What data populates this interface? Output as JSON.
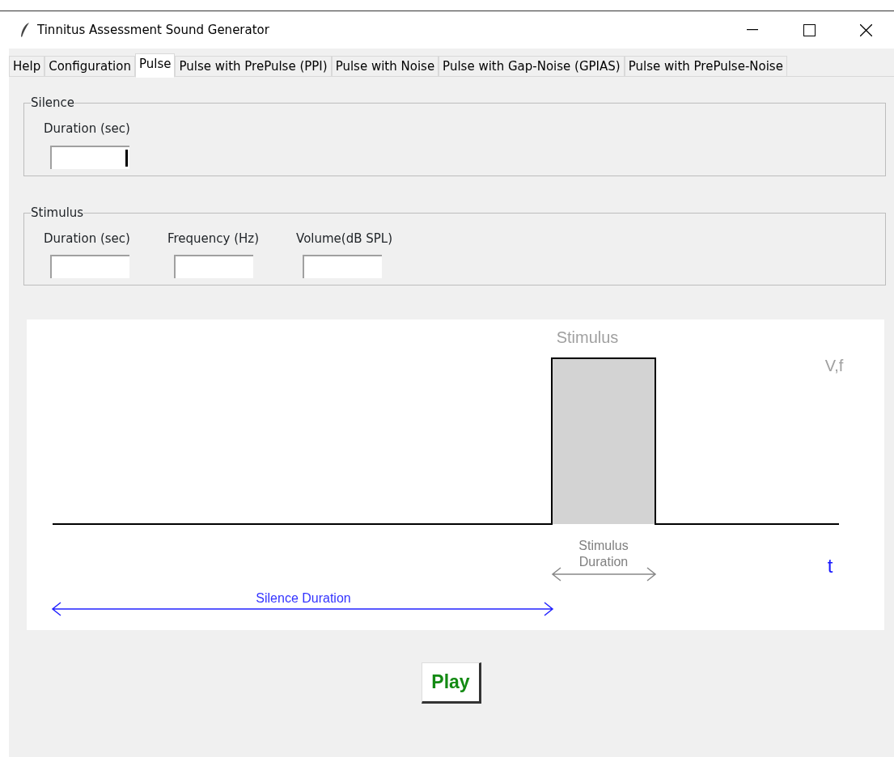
{
  "window": {
    "title": "Tinnitus Assessment Sound Generator"
  },
  "tabs": [
    {
      "label": "Help",
      "selected": false
    },
    {
      "label": "Configuration",
      "selected": false
    },
    {
      "label": "Pulse",
      "selected": true
    },
    {
      "label": "Pulse with PrePulse (PPI)",
      "selected": false
    },
    {
      "label": "Pulse with Noise",
      "selected": false
    },
    {
      "label": "Pulse with Gap-Noise (GPIAS)",
      "selected": false
    },
    {
      "label": "Pulse with PrePulse-Noise",
      "selected": false
    }
  ],
  "groups": [
    {
      "title": "Silence",
      "fields": [
        {
          "label": "Duration (sec)",
          "focused": true
        }
      ]
    },
    {
      "title": "Stimulus",
      "fields": [
        {
          "label": "Duration (sec)",
          "focused": false
        },
        {
          "label": "Frequency (Hz)",
          "focused": false
        },
        {
          "label": "Volume(dB SPL)",
          "focused": false
        }
      ]
    }
  ],
  "diagram": {
    "stimulus_label": "Stimulus",
    "amplitude_label": "V,f",
    "stimulus_duration_label": [
      "Stimulus",
      "Duration"
    ],
    "time_label": "t",
    "silence_duration_label": "Silence Duration"
  },
  "play_button": "Play"
}
